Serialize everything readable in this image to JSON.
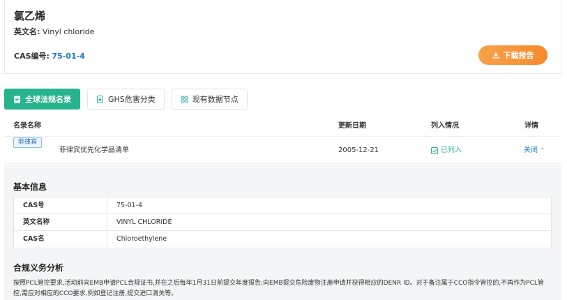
{
  "header": {
    "title": "氯乙烯",
    "en_name_label": "英文名:",
    "en_name_value": "Vinyl chloride",
    "cas_label": "CAS编号:",
    "cas_value": "75-01-4",
    "download_label": "下载报告"
  },
  "tabs": [
    {
      "label": "全球法规名录",
      "icon": "list-icon",
      "active": true
    },
    {
      "label": "GHS危害分类",
      "icon": "document-icon",
      "active": false
    },
    {
      "label": "现有数据节点",
      "icon": "grid-icon",
      "active": false
    }
  ],
  "table": {
    "columns": [
      "名录名称",
      "更新日期",
      "列入情况",
      "详情"
    ],
    "rows": [
      {
        "country_tag": "菲律宾",
        "name": "菲律宾优先化学品清单",
        "date": "2005-12-21",
        "status": "已列入",
        "detail_link": "关闭"
      }
    ]
  },
  "detail": {
    "basic_title": "基本信息",
    "info": [
      {
        "key": "CAS号",
        "value": "75-01-4"
      },
      {
        "key": "英文名称",
        "value": "VINYL CHLORIDE"
      },
      {
        "key": "CAS名",
        "value": "Chloroethylene"
      }
    ],
    "analysis_title": "合规义务分析",
    "analysis_text": "按照PCL管控要求,活动前向EMB申请PCL合规证书,并在之后每年1月31日前提交年度报告;向EMB提交危险废物注册申请并获得相应的DENR ID。对于备注属于CCO指令管控的,不再作为PCL管控,需应对相应的CCO要求,例如登记注册,提交进口清关等。"
  },
  "colors": {
    "accent_green": "#27b48c",
    "link_blue": "#1f78c8",
    "download_orange": "#f58a2b"
  }
}
